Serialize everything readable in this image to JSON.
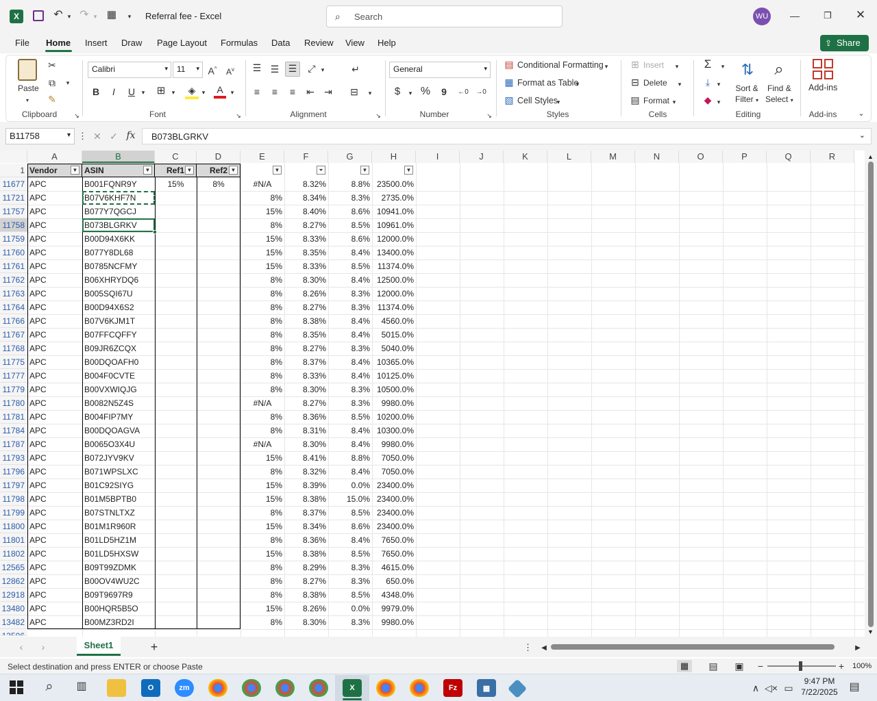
{
  "titlebar": {
    "doc_title": "Referral fee",
    "app_name": "Excel",
    "search_placeholder": "Search",
    "user_initials": "WU"
  },
  "menu": {
    "items": [
      "File",
      "Home",
      "Insert",
      "Draw",
      "Page Layout",
      "Formulas",
      "Data",
      "Review",
      "View",
      "Help"
    ],
    "active": "Home",
    "share_label": "Share"
  },
  "ribbon": {
    "clipboard": {
      "paste": "Paste",
      "group": "Clipboard"
    },
    "font": {
      "name": "Calibri",
      "size": "11",
      "bold": "B",
      "italic": "I",
      "underline": "U",
      "group": "Font"
    },
    "alignment": {
      "group": "Alignment"
    },
    "number": {
      "format": "General",
      "currency": "$",
      "percent": "%",
      "comma": "9",
      "group": "Number"
    },
    "styles": {
      "conditional": "Conditional Formatting",
      "table": "Format as Table",
      "cell_styles": "Cell Styles",
      "group": "Styles"
    },
    "cells": {
      "insert": "Insert",
      "delete": "Delete",
      "format": "Format",
      "group": "Cells"
    },
    "editing": {
      "sort_l1": "Sort &",
      "sort_l2": "Filter",
      "find_l1": "Find &",
      "find_l2": "Select",
      "group": "Editing"
    },
    "addins": {
      "label": "Add-ins",
      "group": "Add-ins"
    }
  },
  "formula_bar": {
    "name_box": "B11758",
    "fx": "fx",
    "content": "B073BLGRKV"
  },
  "grid": {
    "columns": [
      "A",
      "B",
      "C",
      "D",
      "E",
      "F",
      "G",
      "H",
      "I",
      "J",
      "K",
      "L",
      "M",
      "N",
      "O",
      "P",
      "Q",
      "R"
    ],
    "header_row_num": "1",
    "headers": {
      "A": "Vendor",
      "B": "ASIN",
      "C": "Ref1",
      "D": "Ref2"
    },
    "rows": [
      {
        "n": "11677",
        "a": "APC",
        "b": "B001FQNR9Y",
        "c": "15%",
        "d": "8%",
        "e": "#N/A",
        "f": "8.32%",
        "g": "8.8%",
        "h": "23500.0%"
      },
      {
        "n": "11721",
        "a": "APC",
        "b": "B07V6KHF7N",
        "c": "",
        "d": "",
        "e": "8%",
        "f": "8.34%",
        "g": "8.3%",
        "h": "2735.0%"
      },
      {
        "n": "11757",
        "a": "APC",
        "b": "B077Y7QGCJ",
        "c": "",
        "d": "",
        "e": "15%",
        "f": "8.40%",
        "g": "8.6%",
        "h": "10941.0%"
      },
      {
        "n": "11758",
        "a": "APC",
        "b": "B073BLGRKV",
        "c": "",
        "d": "",
        "e": "8%",
        "f": "8.27%",
        "g": "8.5%",
        "h": "10961.0%"
      },
      {
        "n": "11759",
        "a": "APC",
        "b": "B00D94X6KK",
        "c": "",
        "d": "",
        "e": "15%",
        "f": "8.33%",
        "g": "8.6%",
        "h": "12000.0%"
      },
      {
        "n": "11760",
        "a": "APC",
        "b": "B077Y8DL68",
        "c": "",
        "d": "",
        "e": "15%",
        "f": "8.35%",
        "g": "8.4%",
        "h": "13400.0%"
      },
      {
        "n": "11761",
        "a": "APC",
        "b": "B0785NCFMY",
        "c": "",
        "d": "",
        "e": "15%",
        "f": "8.33%",
        "g": "8.5%",
        "h": "11374.0%"
      },
      {
        "n": "11762",
        "a": "APC",
        "b": "B06XHRYDQ6",
        "c": "",
        "d": "",
        "e": "8%",
        "f": "8.30%",
        "g": "8.4%",
        "h": "12500.0%"
      },
      {
        "n": "11763",
        "a": "APC",
        "b": "B005SQI67U",
        "c": "",
        "d": "",
        "e": "8%",
        "f": "8.26%",
        "g": "8.3%",
        "h": "12000.0%"
      },
      {
        "n": "11764",
        "a": "APC",
        "b": "B00D94X6S2",
        "c": "",
        "d": "",
        "e": "8%",
        "f": "8.27%",
        "g": "8.3%",
        "h": "11374.0%"
      },
      {
        "n": "11766",
        "a": "APC",
        "b": "B07V6KJM1T",
        "c": "",
        "d": "",
        "e": "8%",
        "f": "8.38%",
        "g": "8.4%",
        "h": "4560.0%"
      },
      {
        "n": "11767",
        "a": "APC",
        "b": "B07FFCQFFY",
        "c": "",
        "d": "",
        "e": "8%",
        "f": "8.35%",
        "g": "8.4%",
        "h": "5015.0%"
      },
      {
        "n": "11768",
        "a": "APC",
        "b": "B09JR6ZCQX",
        "c": "",
        "d": "",
        "e": "8%",
        "f": "8.27%",
        "g": "8.3%",
        "h": "5040.0%"
      },
      {
        "n": "11775",
        "a": "APC",
        "b": "B00DQOAFH0",
        "c": "",
        "d": "",
        "e": "8%",
        "f": "8.37%",
        "g": "8.4%",
        "h": "10365.0%"
      },
      {
        "n": "11777",
        "a": "APC",
        "b": "B004F0CVTE",
        "c": "",
        "d": "",
        "e": "8%",
        "f": "8.33%",
        "g": "8.4%",
        "h": "10125.0%"
      },
      {
        "n": "11779",
        "a": "APC",
        "b": "B00VXWIQJG",
        "c": "",
        "d": "",
        "e": "8%",
        "f": "8.30%",
        "g": "8.3%",
        "h": "10500.0%"
      },
      {
        "n": "11780",
        "a": "APC",
        "b": "B0082N5Z4S",
        "c": "",
        "d": "",
        "e": "#N/A",
        "f": "8.27%",
        "g": "8.3%",
        "h": "9980.0%"
      },
      {
        "n": "11781",
        "a": "APC",
        "b": "B004FIP7MY",
        "c": "",
        "d": "",
        "e": "8%",
        "f": "8.36%",
        "g": "8.5%",
        "h": "10200.0%"
      },
      {
        "n": "11784",
        "a": "APC",
        "b": "B00DQOAGVA",
        "c": "",
        "d": "",
        "e": "8%",
        "f": "8.31%",
        "g": "8.4%",
        "h": "10300.0%"
      },
      {
        "n": "11787",
        "a": "APC",
        "b": "B0065O3X4U",
        "c": "",
        "d": "",
        "e": "#N/A",
        "f": "8.30%",
        "g": "8.4%",
        "h": "9980.0%"
      },
      {
        "n": "11793",
        "a": "APC",
        "b": "B072JYV9KV",
        "c": "",
        "d": "",
        "e": "15%",
        "f": "8.41%",
        "g": "8.8%",
        "h": "7050.0%"
      },
      {
        "n": "11796",
        "a": "APC",
        "b": "B071WPSLXC",
        "c": "",
        "d": "",
        "e": "8%",
        "f": "8.32%",
        "g": "8.4%",
        "h": "7050.0%"
      },
      {
        "n": "11797",
        "a": "APC",
        "b": "B01C92SIYG",
        "c": "",
        "d": "",
        "e": "15%",
        "f": "8.39%",
        "g": "0.0%",
        "h": "23400.0%"
      },
      {
        "n": "11798",
        "a": "APC",
        "b": "B01M5BPTB0",
        "c": "",
        "d": "",
        "e": "15%",
        "f": "8.38%",
        "g": "15.0%",
        "h": "23400.0%"
      },
      {
        "n": "11799",
        "a": "APC",
        "b": "B07STNLTXZ",
        "c": "",
        "d": "",
        "e": "8%",
        "f": "8.37%",
        "g": "8.5%",
        "h": "23400.0%"
      },
      {
        "n": "11800",
        "a": "APC",
        "b": "B01M1R960R",
        "c": "",
        "d": "",
        "e": "15%",
        "f": "8.34%",
        "g": "8.6%",
        "h": "23400.0%"
      },
      {
        "n": "11801",
        "a": "APC",
        "b": "B01LD5HZ1M",
        "c": "",
        "d": "",
        "e": "8%",
        "f": "8.36%",
        "g": "8.4%",
        "h": "7650.0%"
      },
      {
        "n": "11802",
        "a": "APC",
        "b": "B01LD5HXSW",
        "c": "",
        "d": "",
        "e": "15%",
        "f": "8.38%",
        "g": "8.5%",
        "h": "7650.0%"
      },
      {
        "n": "12565",
        "a": "APC",
        "b": "B09T99ZDMK",
        "c": "",
        "d": "",
        "e": "8%",
        "f": "8.29%",
        "g": "8.3%",
        "h": "4615.0%"
      },
      {
        "n": "12862",
        "a": "APC",
        "b": "B00OV4WU2C",
        "c": "",
        "d": "",
        "e": "8%",
        "f": "8.27%",
        "g": "8.3%",
        "h": "650.0%"
      },
      {
        "n": "12918",
        "a": "APC",
        "b": "B09T9697R9",
        "c": "",
        "d": "",
        "e": "8%",
        "f": "8.38%",
        "g": "8.5%",
        "h": "4348.0%"
      },
      {
        "n": "13480",
        "a": "APC",
        "b": "B00HQR5B5O",
        "c": "",
        "d": "",
        "e": "15%",
        "f": "8.26%",
        "g": "0.0%",
        "h": "9979.0%"
      },
      {
        "n": "13482",
        "a": "APC",
        "b": "B00MZ3RD2I",
        "c": "",
        "d": "",
        "e": "8%",
        "f": "8.30%",
        "g": "8.3%",
        "h": "9980.0%"
      }
    ],
    "partial_row": "13506"
  },
  "sheets": {
    "active": "Sheet1",
    "add": "+"
  },
  "status": {
    "message": "Select destination and press ENTER or choose Paste",
    "zoom": "100%"
  },
  "taskbar": {
    "time": "9:47 PM",
    "date": "7/22/2025"
  },
  "colors": {
    "excel_green": "#1e7145",
    "selection": "#217346",
    "header_fill": "#d9d9d9"
  }
}
